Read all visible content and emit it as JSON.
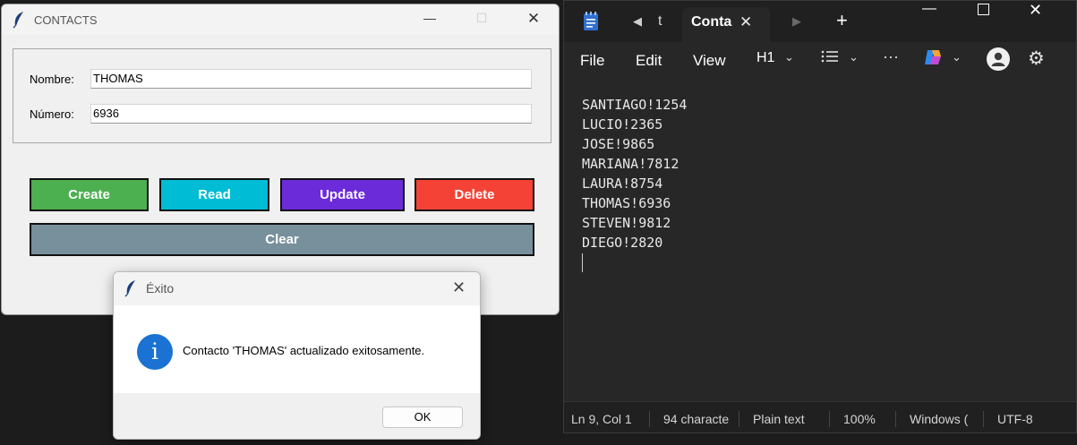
{
  "contacts_window": {
    "title": "CONTACTS",
    "nombre_label": "Nombre:",
    "nombre_value": "THOMAS",
    "numero_label": "Número:",
    "numero_value": "6936",
    "buttons": {
      "create": "Create",
      "read": "Read",
      "update": "Update",
      "delete": "Delete",
      "clear": "Clear"
    },
    "colors": {
      "create": "#4caf50",
      "read": "#00bcd4",
      "update": "#6c2bd9",
      "delete": "#f44336",
      "clear": "#78909c"
    }
  },
  "dialog": {
    "title": "Éxito",
    "message": "Contacto 'THOMAS' actualizado exitosamente.",
    "icon_letter": "i",
    "ok_label": "OK"
  },
  "notepad": {
    "tab_prev_label": "t",
    "tab_active_label": "Conta",
    "menu": {
      "file": "File",
      "edit": "Edit",
      "view": "View",
      "heading": "H1"
    },
    "lines": [
      "SANTIAGO!1254",
      "LUCIO!2365",
      "JOSE!9865",
      "MARIANA!7812",
      "LAURA!8754",
      "THOMAS!6936",
      "STEVEN!9812",
      "DIEGO!2820"
    ],
    "status": {
      "position": "Ln 9, Col 1",
      "chars": "94 characte",
      "format": "Plain text",
      "zoom": "100%",
      "line_ending": "Windows (",
      "encoding": "UTF-8"
    }
  }
}
